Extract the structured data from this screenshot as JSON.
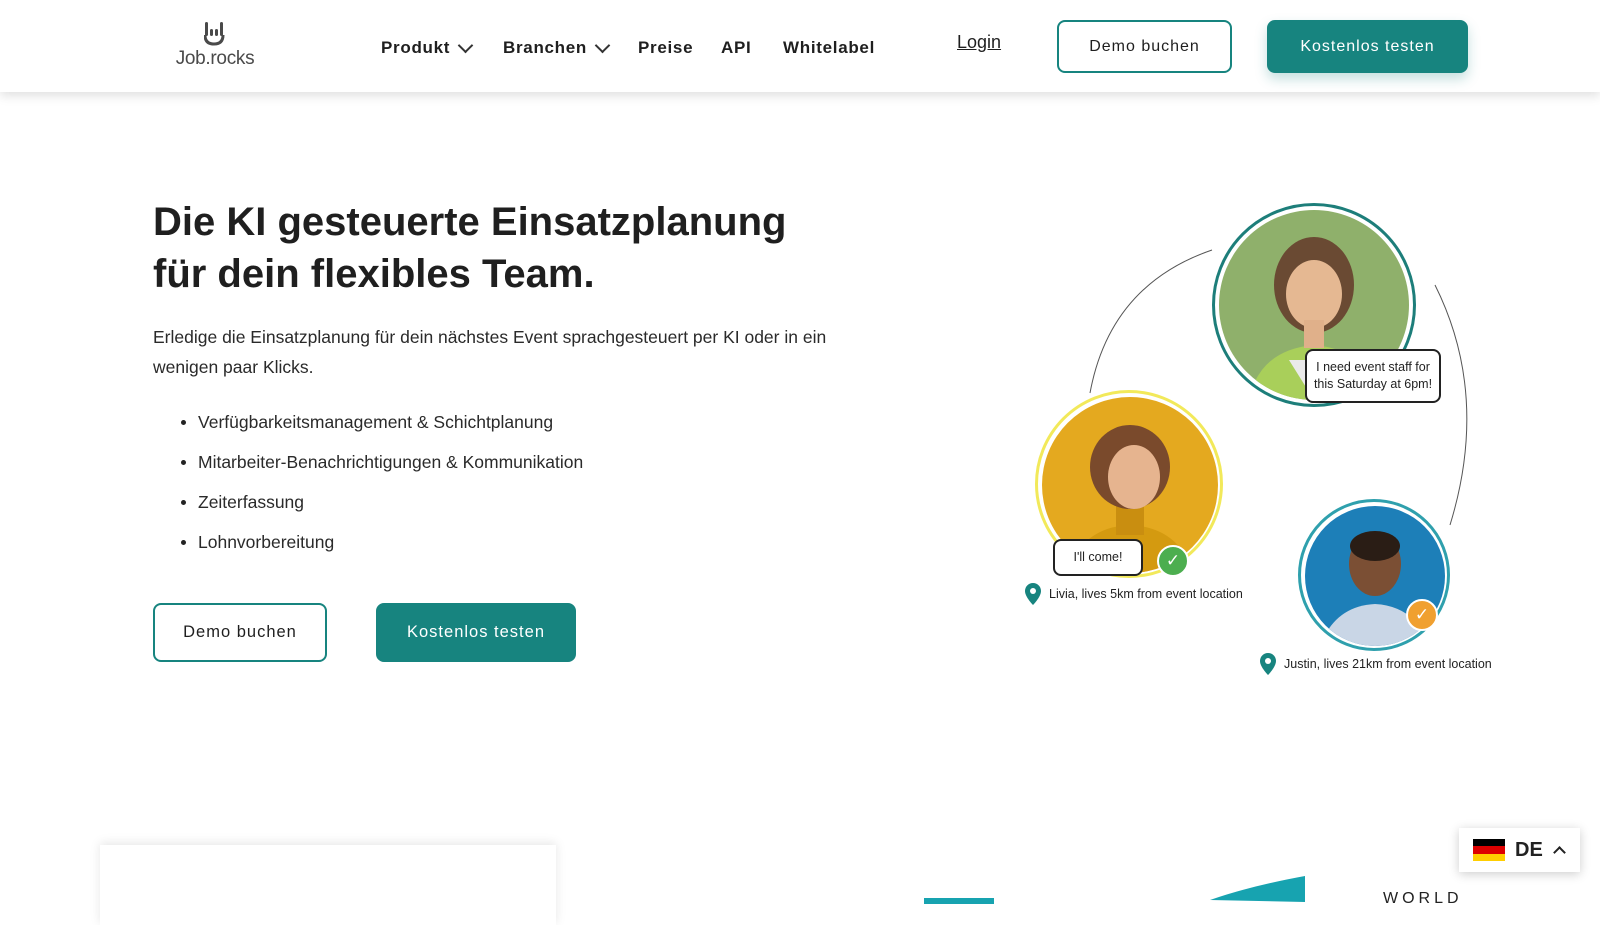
{
  "header": {
    "logo_text": "Job.rocks",
    "nav": [
      {
        "label": "Produkt",
        "dropdown": true
      },
      {
        "label": "Branchen",
        "dropdown": true
      },
      {
        "label": "Preise",
        "dropdown": false
      },
      {
        "label": "API",
        "dropdown": false
      },
      {
        "label": "Whitelabel",
        "dropdown": false
      }
    ],
    "login_label": "Login",
    "demo_label": "Demo buchen",
    "trial_label": "Kostenlos testen"
  },
  "hero": {
    "title_line1": "Die KI gesteuerte Einsatzplanung",
    "title_line2": "für dein flexibles Team.",
    "subtitle": "Erledige die Einsatzplanung für dein nächstes Event sprachgesteuert per KI oder in ein wenigen paar Klicks.",
    "features": [
      "Verfügbarkeitsmanagement & Schichtplanung",
      "Mitarbeiter-Benachrichtigungen & Kommunikation",
      "Zeiterfassung",
      "Lohnvorbereitung"
    ],
    "demo_label": "Demo buchen",
    "trial_label": "Kostenlos testen"
  },
  "illustration": {
    "manager_bubble_line1": "I need event staff for",
    "manager_bubble_line2": "this Saturday at 6pm!",
    "livia_bubble": "I'll come!",
    "livia_location": "Livia, lives 5km from event location",
    "justin_location": "Justin, lives 21km from event location"
  },
  "bottom": {
    "world_text": "WORLD"
  },
  "language": {
    "code": "DE"
  },
  "colors": {
    "brand_teal": "#17847f",
    "text_dark": "#1f1f1f",
    "check_green": "#4cae4f",
    "check_orange": "#f0a030",
    "yellow_ring": "#f2e95a"
  },
  "icons": [
    "chevron-down-icon",
    "location-pin-icon",
    "check-icon",
    "germany-flag-icon",
    "chevron-up-icon"
  ]
}
